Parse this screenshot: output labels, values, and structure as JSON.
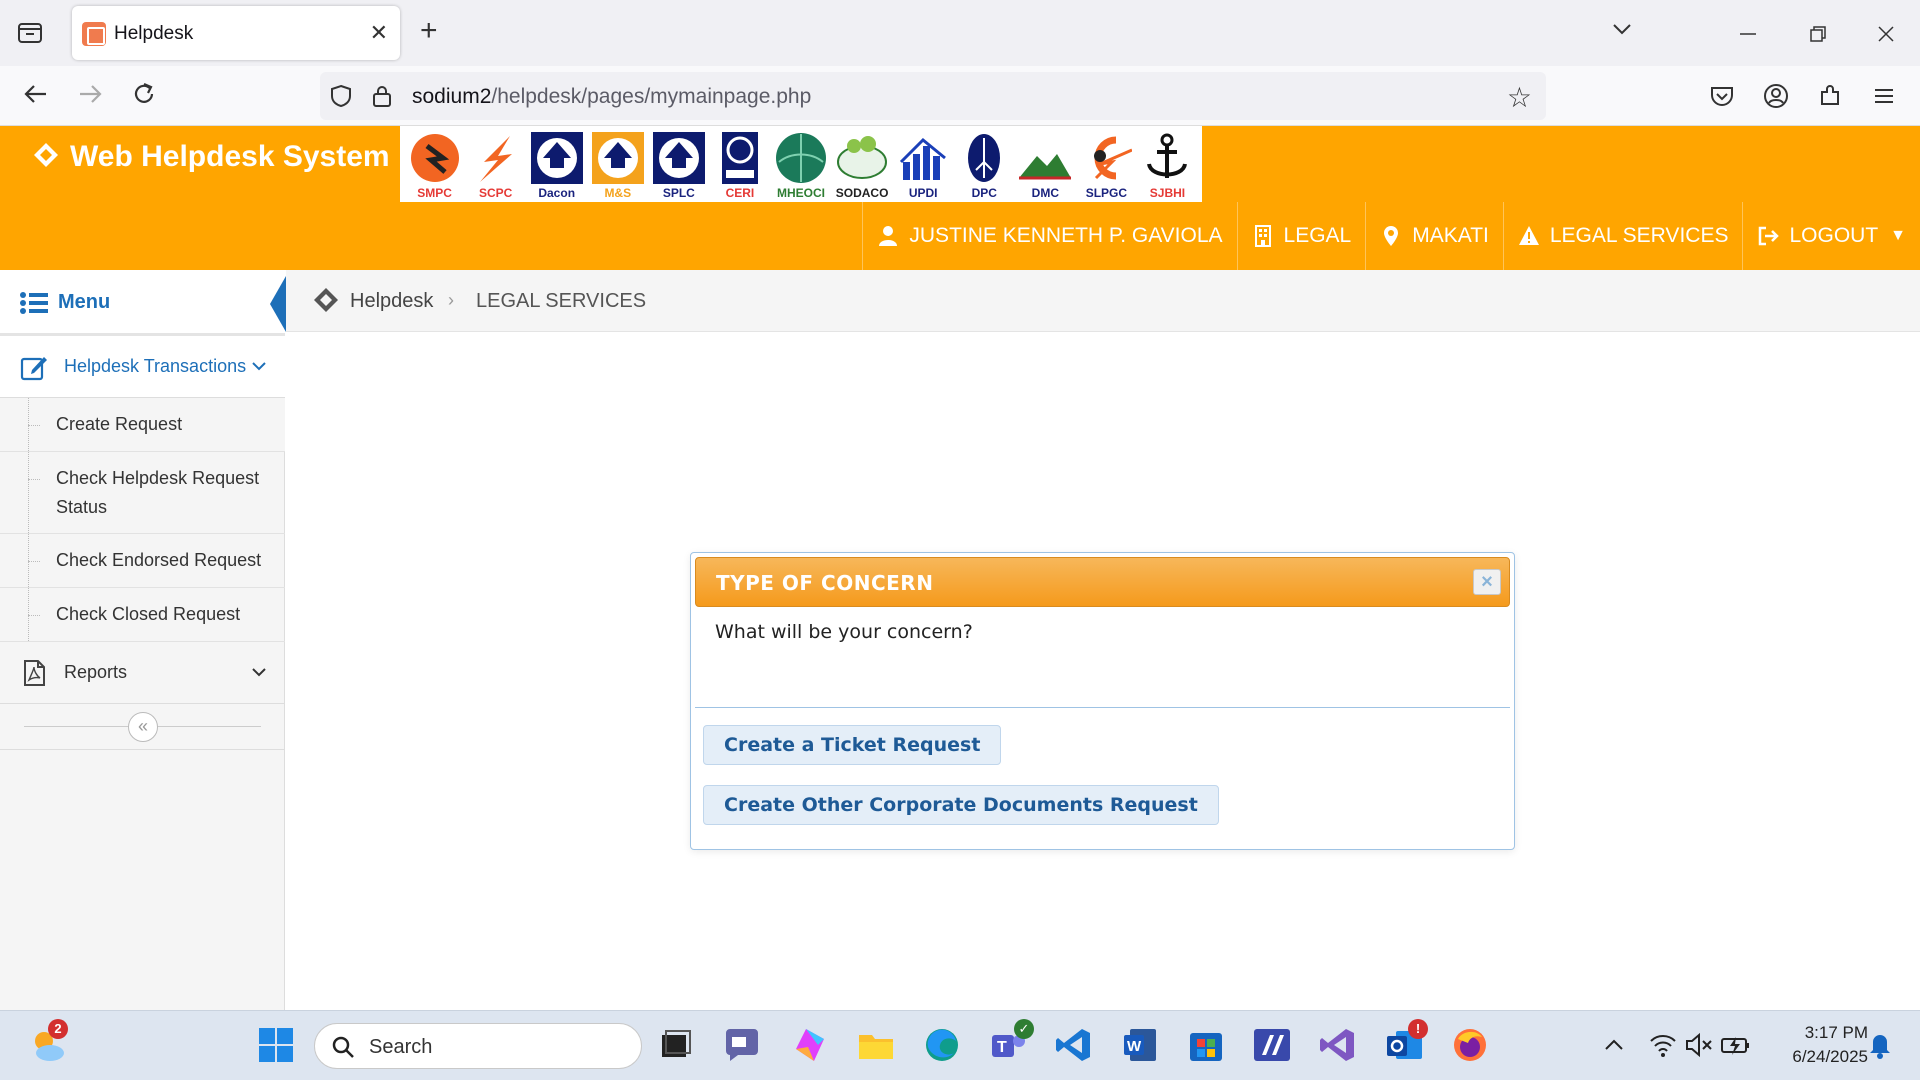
{
  "browser": {
    "tab_title": "Helpdesk",
    "url_host": "sodium2",
    "url_path": "/helpdesk/pages/mymainpage.php"
  },
  "header": {
    "brand": "Web Helpdesk System",
    "logos": [
      "SMPC",
      "SCPC",
      "Dacon",
      "M&S",
      "SPLC",
      "CERI",
      "MHEOCI",
      "SODACO",
      "UPDI",
      "DPC",
      "DMC",
      "SLPGC",
      "SJBHI"
    ],
    "user": "JUSTINE KENNETH P. GAVIOLA",
    "department": "LEGAL",
    "location": "MAKATI",
    "section": "LEGAL SERVICES",
    "logout": "LOGOUT"
  },
  "sidebar": {
    "menu_label": "Menu",
    "groups": [
      {
        "label": "Helpdesk Transactions",
        "items": [
          "Create Request",
          "Check Helpdesk Request Status",
          "Check Endorsed Request",
          "Check Closed Request"
        ]
      },
      {
        "label": "Reports"
      }
    ]
  },
  "breadcrumb": {
    "home": "Helpdesk",
    "current": "LEGAL SERVICES"
  },
  "dialog": {
    "title": "TYPE OF CONCERN",
    "close_symbol": "×",
    "question": "What will be your concern?",
    "buttons": [
      "Create a Ticket Request",
      "Create Other Corporate Documents Request"
    ]
  },
  "taskbar": {
    "search_placeholder": "Search",
    "time": "3:17 PM",
    "date": "6/24/2025",
    "weather_badge": "2",
    "outlook_badge": "!"
  },
  "colors": {
    "header_orange": "#ffa500",
    "accent_blue": "#1d6fb8",
    "dialog_title": "#f59a1c"
  }
}
